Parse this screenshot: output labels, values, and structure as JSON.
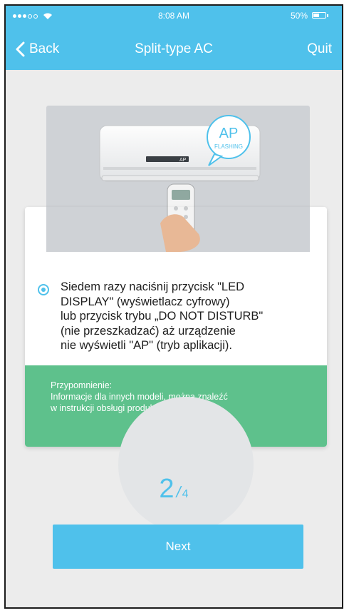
{
  "status_bar": {
    "time": "8:08 AM",
    "battery": "50%",
    "battery_level": 0.5
  },
  "navbar": {
    "back_label": "Back",
    "title": "Split-type AC",
    "quit_label": "Quit"
  },
  "illustration": {
    "bubble_title": "AP",
    "bubble_subtitle": "FLASHING",
    "display_text": "AP"
  },
  "instruction": {
    "lines": [
      "Siedem razy naciśnij przycisk \"LED",
      "DISPLAY\" (wyświetlacz cyfrowy)",
      "lub przycisk trybu „DO NOT DISTURB\"",
      "(nie przeszkadzać) aż urządzenie",
      "nie wyświetli \"AP\" (tryb aplikacji)."
    ]
  },
  "reminder": {
    "title": "Przypomnienie:",
    "line1": "Informacje dla innych modeli, można znaleźć",
    "line2": "w instrukcji obsługi produktu."
  },
  "step": {
    "current": "2",
    "separator": "/",
    "total": "4"
  },
  "next_label": "Next",
  "colors": {
    "accent": "#4fc1eb",
    "reminder_bg": "#5ec18c",
    "page_bg": "#ececec"
  }
}
